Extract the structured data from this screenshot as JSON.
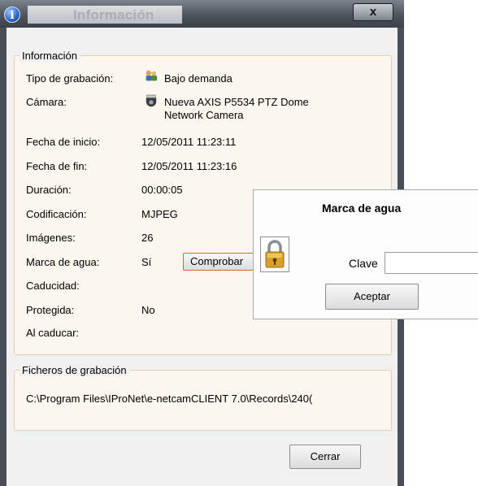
{
  "window": {
    "title": "Información",
    "close_glyph": "x",
    "info_glyph": "i"
  },
  "info_group": {
    "title": "Información",
    "rows": [
      {
        "label": "Tipo de grabación:",
        "value": "Bajo demanda"
      },
      {
        "label": "Cámara:",
        "value_line1": "Nueva AXIS P5534 PTZ Dome",
        "value_line2": "Network Camera"
      },
      {
        "label": "Fecha de inicio:",
        "value": "12/05/2011 11:23:11"
      },
      {
        "label": "Fecha de fin:",
        "value": "12/05/2011 11:23:16"
      },
      {
        "label": "Duración:",
        "value": "00:00:05"
      },
      {
        "label": "Codificación:",
        "value": "MJPEG"
      },
      {
        "label": "Imágenes:",
        "value": "26"
      },
      {
        "label": "Marca de agua:",
        "value": "Sí"
      },
      {
        "label": "Caducidad:",
        "value": ""
      },
      {
        "label": "Protegida:",
        "value": "No"
      },
      {
        "label": "Al caducar:",
        "value": ""
      }
    ],
    "check_button": "Comprobar"
  },
  "files_group": {
    "title": "Ficheros de grabación",
    "path": "C:\\Program Files\\IProNet\\e-netcamCLIENT 7.0\\Records\\240("
  },
  "close_button": "Cerrar",
  "watermark_popup": {
    "title": "Marca de agua",
    "key_label": "Clave",
    "key_value": "",
    "accept_button": "Aceptar"
  },
  "icons": {
    "record_type": "recording-people-icon",
    "camera": "dome-camera-icon",
    "lock": "padlock-icon",
    "info": "info-icon"
  }
}
